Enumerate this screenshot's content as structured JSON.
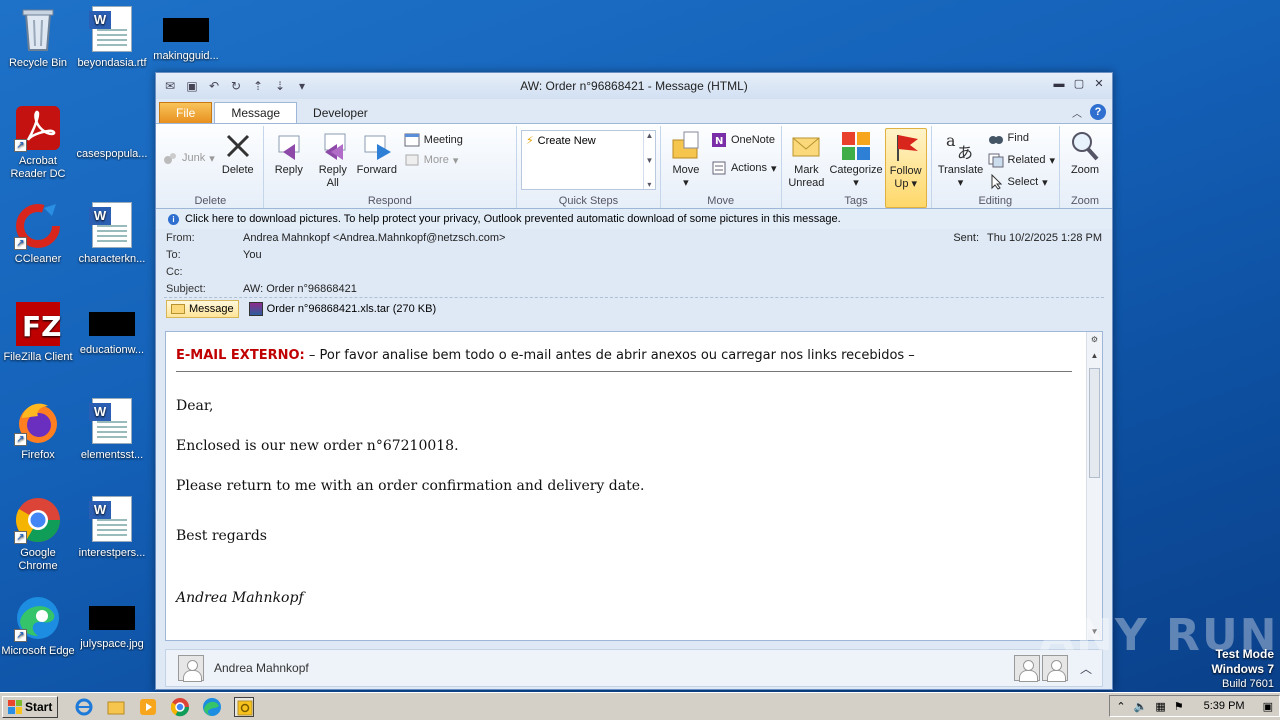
{
  "desktop": {
    "icons": [
      {
        "label": "Recycle Bin"
      },
      {
        "label": "beyondasia.rtf"
      },
      {
        "label": "makingguid..."
      },
      {
        "label": "Acrobat Reader DC"
      },
      {
        "label": "casespopula..."
      },
      {
        "label": "CCleaner"
      },
      {
        "label": "characterkn..."
      },
      {
        "label": "FileZilla Client"
      },
      {
        "label": "educationw..."
      },
      {
        "label": "Firefox"
      },
      {
        "label": "elementsst..."
      },
      {
        "label": "Google Chrome"
      },
      {
        "label": "interestpers..."
      },
      {
        "label": "Microsoft Edge"
      },
      {
        "label": "julyspace.jpg"
      }
    ]
  },
  "window": {
    "title": "AW:  Order n°96868421  -  Message (HTML)",
    "tabs": [
      "File",
      "Message",
      "Developer"
    ]
  },
  "ribbon": {
    "delete_group": {
      "name": "Delete",
      "junk": "Junk",
      "delete": "Delete"
    },
    "respond_group": {
      "name": "Respond",
      "reply": "Reply",
      "reply_all_1": "Reply",
      "reply_all_2": "All",
      "forward": "Forward",
      "meeting": "Meeting",
      "more": "More"
    },
    "quicksteps_group": {
      "name": "Quick Steps",
      "create_new": "Create New"
    },
    "move_group": {
      "name": "Move",
      "move": "Move",
      "onenote": "OneNote",
      "actions": "Actions"
    },
    "tags_group": {
      "name": "Tags",
      "mark_unread_1": "Mark",
      "mark_unread_2": "Unread",
      "categorize": "Categorize",
      "follow_up_1": "Follow",
      "follow_up_2": "Up"
    },
    "editing_group": {
      "name": "Editing",
      "translate": "Translate",
      "find": "Find",
      "related": "Related",
      "select": "Select"
    },
    "zoom_group": {
      "name": "Zoom",
      "zoom": "Zoom"
    }
  },
  "message": {
    "infobar": "Click here to download pictures. To help protect your privacy, Outlook prevented automatic download of some pictures in this message.",
    "from_label": "From:",
    "from": "Andrea Mahnkopf <Andrea.Mahnkopf@netzsch.com>",
    "to_label": "To:",
    "to": "You",
    "cc_label": "Cc:",
    "subject_label": "Subject:",
    "subject": "AW:  Order n°96868421",
    "sent_label": "Sent:",
    "sent": "Thu 10/2/2025 1:28 PM",
    "message_tab": "Message",
    "attachment": "Order n°96868421.xls.tar (270 KB)"
  },
  "body": {
    "banner_red": "E-MAIL EXTERNO:",
    "banner_text": " – Por favor analise bem todo o e-mail antes de abrir anexos ou carregar nos links recebidos –",
    "greeting": "Dear,",
    "line1": "Enclosed is our new order n°67210018.",
    "line2": "Please return to me with an order confirmation and delivery date.",
    "closing": "Best regards",
    "signature": "Andrea Mahnkopf"
  },
  "people_pane": {
    "name": "Andrea Mahnkopf"
  },
  "watermark": {
    "text": "ANY RUN"
  },
  "os": {
    "testmode_1": "Test Mode",
    "testmode_2": "Windows 7",
    "testmode_3": "Build 7601",
    "start": "Start",
    "clock": "5:39 PM"
  }
}
